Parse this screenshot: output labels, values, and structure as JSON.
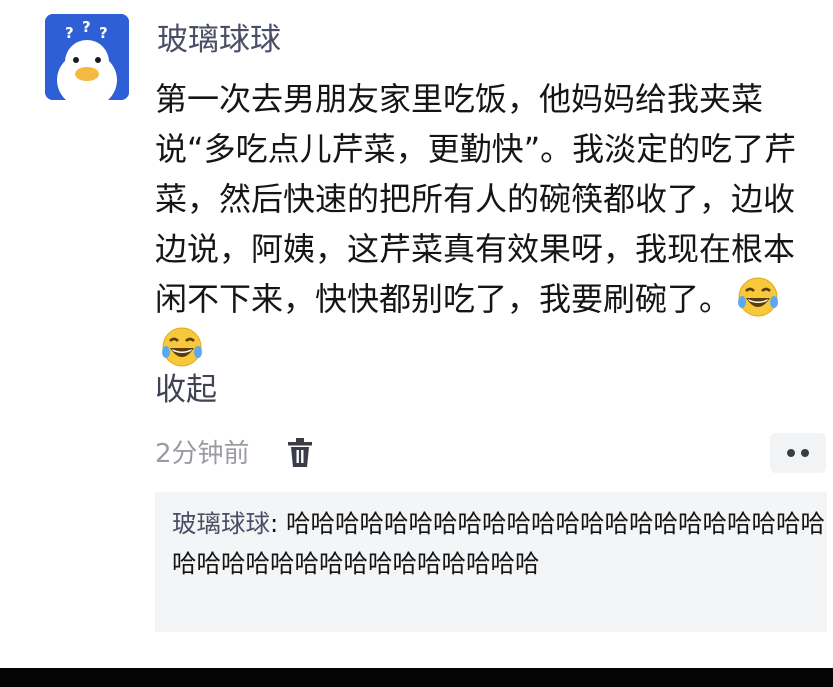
{
  "post": {
    "author_name": "玻璃球球",
    "body": "第一次去男朋友家里吃饭，他妈妈给我夹菜说“多吃点儿芹菜，更勤快”。我淡定的吃了芹菜，然后快速的把所有人的碗筷都收了，边收边说，阿姨，这芹菜真有效果呀，我现在根本闲不下来，快快都别吃了，我要刷碗了。",
    "emoji": [
      "laughing-tears-emoji",
      "laughing-tears-emoji"
    ],
    "collapse_label": "收起",
    "timestamp": "2分钟前"
  },
  "reply": {
    "author": "玻璃球球",
    "separator": ": ",
    "text": "哈哈哈哈哈哈哈哈哈哈哈哈哈哈哈哈哈哈哈哈哈哈哈哈哈哈哈哈哈哈哈哈哈哈哈哈哈"
  },
  "icons": {
    "avatar": "duck-with-question-marks",
    "delete": "trash-icon",
    "more": "more-dots-icon"
  },
  "colors": {
    "avatar_bg": "#2f5fd4",
    "author_text": "#4a4f66",
    "timestamp_text": "#9a9ca3",
    "reply_bg": "#f4f5f7"
  }
}
